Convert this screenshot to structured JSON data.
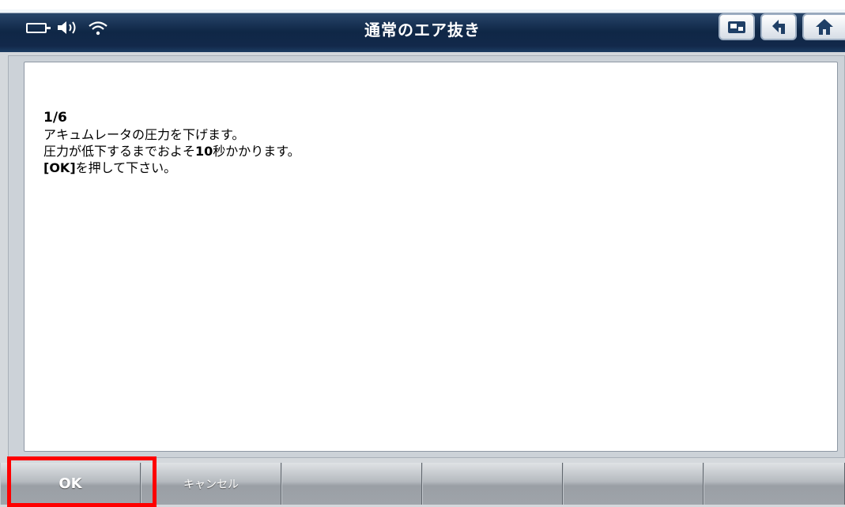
{
  "header": {
    "title": "通常のエア抜き",
    "status_icons": [
      "battery-icon",
      "speaker-icon",
      "wifi-icon"
    ],
    "buttons": [
      "photo-icon",
      "back-arrow-icon",
      "home-icon"
    ]
  },
  "message": {
    "step": "1/6",
    "line1": "アキュムレータの圧力を下げます。",
    "line2_pre": "圧力が低下するまでおよそ",
    "line2_bold": "10",
    "line2_post": "秒かかります。",
    "line3_bold": "[OK]",
    "line3_post": "を押して下さい。"
  },
  "footer": {
    "ok_label": "OK",
    "cancel_label": "キャンセル"
  },
  "colors": {
    "titlebar": "#0f2746",
    "highlight": "#ff0000"
  }
}
